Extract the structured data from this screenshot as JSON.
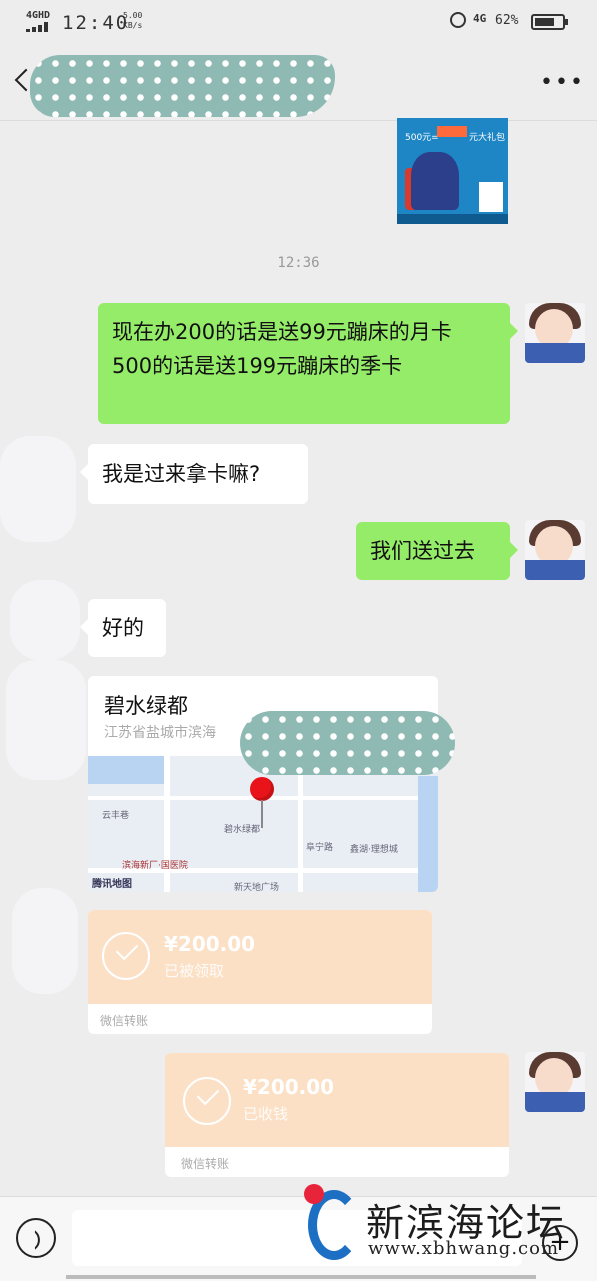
{
  "status_bar": {
    "network": "4GHD",
    "time": "12:40",
    "speed": "5.00 KB/s",
    "network2": "4G",
    "battery": "62%"
  },
  "image_message": {
    "headline": "500元=",
    "tag": "元大礼包"
  },
  "timestamp": "12:36",
  "messages": {
    "m1_line1": "现在办200的话是送99元蹦床的月卡",
    "m1_line2": "500的话是送199元蹦床的季卡",
    "m2": "我是过来拿卡嘛?",
    "m3": "我们送过去",
    "m4": "好的"
  },
  "location": {
    "name": "碧水绿都",
    "address": "江苏省盐城市滨海",
    "map_labels": [
      "云丰巷",
      "碧水绿都",
      "鑫湖·理想城",
      "滨海新厂·国医院",
      "阜宁路",
      "新天地广场"
    ],
    "map_brand": "腾讯地图"
  },
  "transfer1": {
    "amount": "¥200.00",
    "status": "已被领取",
    "footer": "微信转账"
  },
  "transfer2": {
    "amount": "¥200.00",
    "status": "已收钱",
    "footer": "微信转账"
  },
  "watermark": {
    "name": "新滨海论坛",
    "url": "www.xbhwang.com"
  },
  "colors": {
    "sent_bubble": "#95ec69",
    "received_bubble": "#ffffff",
    "transfer": "#fbe0c5",
    "background": "#ededed"
  }
}
